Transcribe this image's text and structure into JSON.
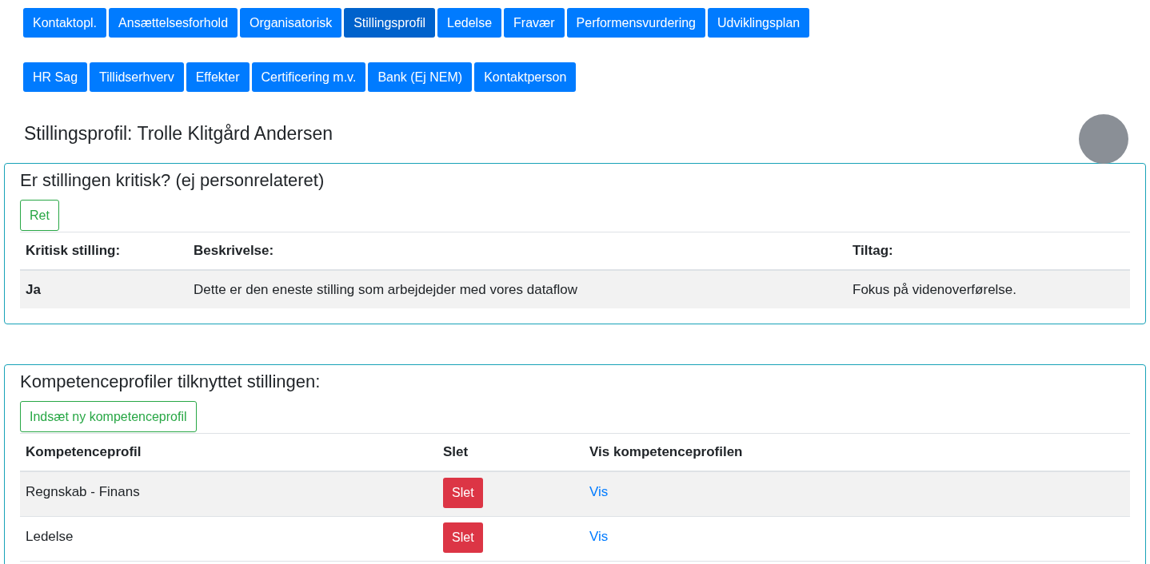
{
  "tab_rows": [
    [
      {
        "label": "Kontaktopl.",
        "selected": false
      },
      {
        "label": "Ansættelsesforhold",
        "selected": false
      },
      {
        "label": "Organisatorisk",
        "selected": false
      },
      {
        "label": "Stillingsprofil",
        "selected": true
      },
      {
        "label": "Ledelse",
        "selected": false
      },
      {
        "label": "Fravær",
        "selected": false
      },
      {
        "label": "Performensvurdering",
        "selected": false
      },
      {
        "label": "Udviklingsplan",
        "selected": false
      }
    ],
    [
      {
        "label": "HR Sag",
        "selected": false
      },
      {
        "label": "Tillidserhverv",
        "selected": false
      },
      {
        "label": "Effekter",
        "selected": false
      },
      {
        "label": "Certificering m.v.",
        "selected": false
      },
      {
        "label": "Bank (Ej NEM)",
        "selected": false
      },
      {
        "label": "Kontaktperson",
        "selected": false
      }
    ]
  ],
  "page_title": "Stillingsprofil: Trolle Klitgård Andersen",
  "critical": {
    "heading": "Er stillingen kritisk? (ej personrelateret)",
    "edit_button": "Ret",
    "columns": [
      "Kritisk stilling:",
      "Beskrivelse:",
      "Tiltag:"
    ],
    "rows": [
      [
        "Ja",
        "Dette er den eneste stilling som arbejdejder med vores dataflow",
        "Fokus på videnoverførelse."
      ]
    ]
  },
  "competence": {
    "heading": "Kompetenceprofiler tilknyttet stillingen:",
    "add_button": "Indsæt ny kompetenceprofil",
    "columns": [
      "Kompetenceprofil",
      "Slet",
      "Vis kompetenceprofilen"
    ],
    "rows": [
      {
        "name": "Regnskab - Finans",
        "delete_button": "Slet",
        "view_link": "Vis"
      },
      {
        "name": "Ledelse",
        "delete_button": "Slet",
        "view_link": "Vis"
      }
    ]
  }
}
